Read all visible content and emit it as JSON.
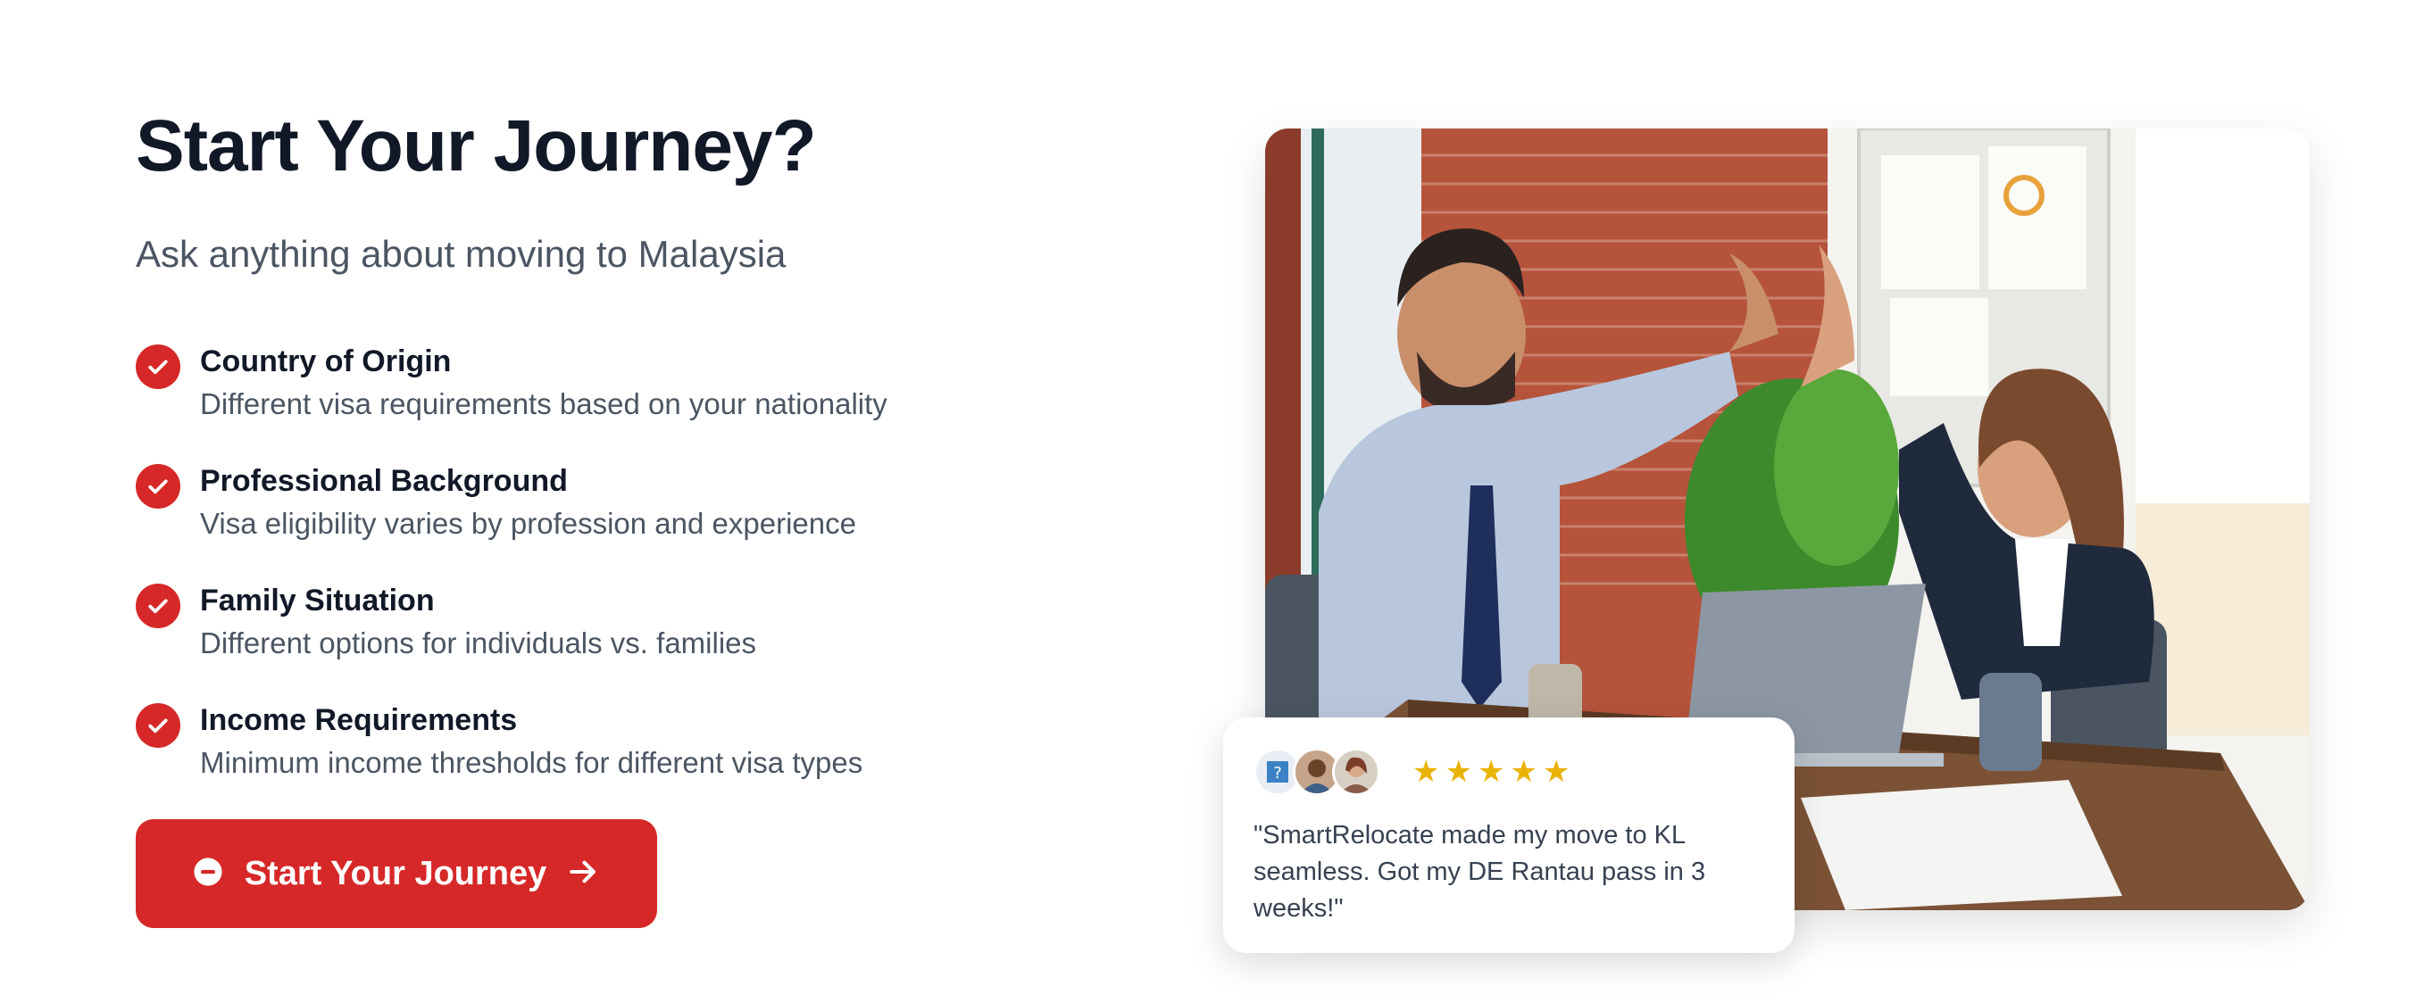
{
  "hero": {
    "title": "Start Your Journey?",
    "subtitle": "Ask anything about moving to Malaysia"
  },
  "features": [
    {
      "title": "Country of Origin",
      "description": "Different visa requirements based on your nationality"
    },
    {
      "title": "Professional Background",
      "description": "Visa eligibility varies by profession and experience"
    },
    {
      "title": "Family Situation",
      "description": "Different options for individuals vs. families"
    },
    {
      "title": "Income Requirements",
      "description": "Minimum income thresholds for different visa types"
    }
  ],
  "cta": {
    "label": "Start Your Journey",
    "icon_left": "minus-circle-icon",
    "icon_right": "arrow-right-icon"
  },
  "image": {
    "subject": "office-high-five-photo"
  },
  "review": {
    "rating": 5,
    "text": "\"SmartRelocate made my move to KL seamless. Got my DE Rantau pass in 3 weeks!\""
  },
  "colors": {
    "accent": "#d62828",
    "heading": "#111827",
    "body": "#4b5563",
    "star": "#eab308"
  }
}
